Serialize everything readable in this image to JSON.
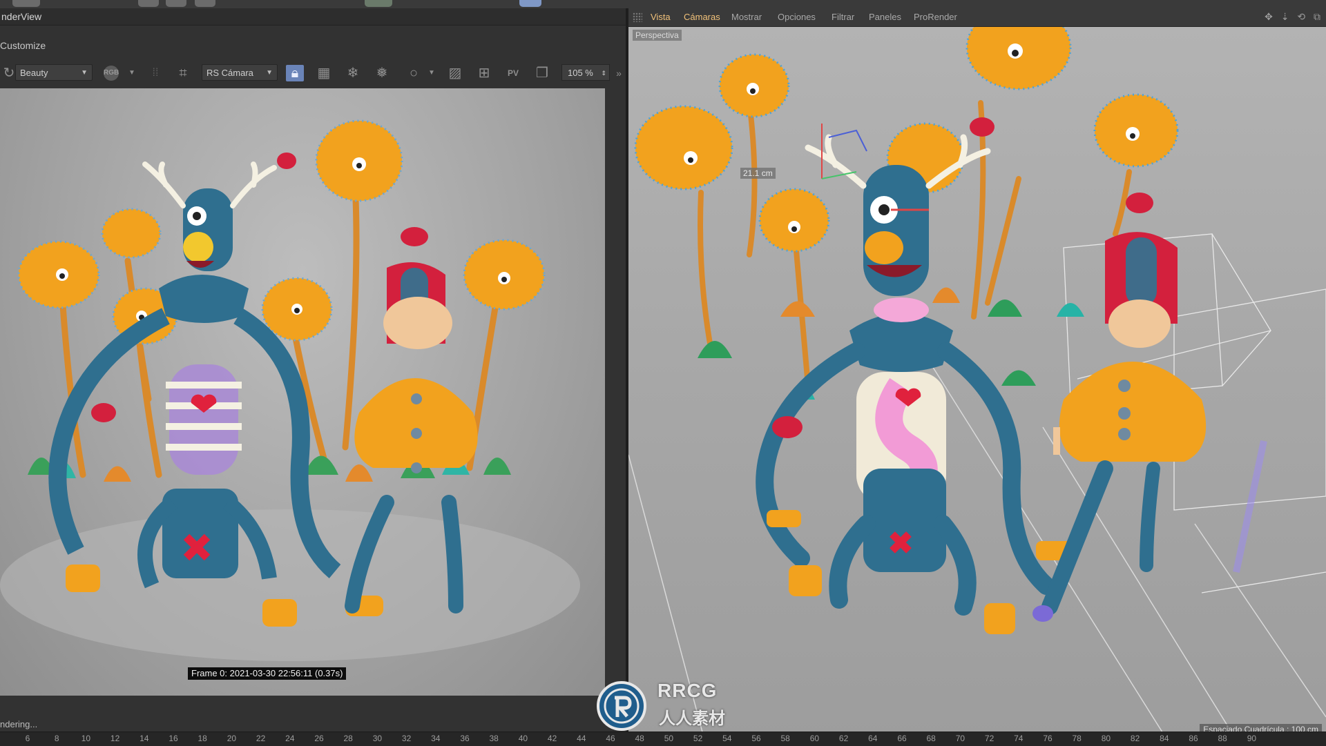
{
  "left_panel": {
    "title": "nderView",
    "customize": "Customize",
    "pass_dropdown": "Beauty",
    "channel_label": "RGB",
    "camera_dropdown": "RS Cámara",
    "zoom": "105 %",
    "frame_info": "Frame 0: 2021-03-30 22:56:11 (0.37s)",
    "status": "ndering..."
  },
  "right_panel": {
    "menus": [
      "Vista",
      "Cámaras",
      "Mostrar",
      "Opciones",
      "Filtrar",
      "Paneles",
      "ProRender"
    ],
    "view_label": "Perspectiva",
    "dimension_label": "21.1 cm",
    "grid_spacing": "Espaciado Cuadrícula : 100 cm"
  },
  "timeline": {
    "ticks": [
      "6",
      "8",
      "10",
      "12",
      "14",
      "16",
      "18",
      "20",
      "22",
      "24",
      "26",
      "28",
      "30",
      "32",
      "34",
      "36",
      "38",
      "40",
      "42",
      "44",
      "46",
      "48",
      "50",
      "52",
      "54",
      "56",
      "58",
      "60",
      "62",
      "64",
      "66",
      "68",
      "70",
      "72",
      "74",
      "76",
      "78",
      "80",
      "82",
      "84",
      "86",
      "88",
      "90"
    ]
  },
  "watermark": {
    "brand": "RRCG",
    "sub": "人人素材"
  },
  "colors": {
    "accent_menu": "#f2c27a",
    "active_tool": "#6a84b8",
    "monster_blue": "#2f6f8f",
    "puffer_orange": "#f2a21e",
    "stem_orange": "#d98a2b"
  }
}
